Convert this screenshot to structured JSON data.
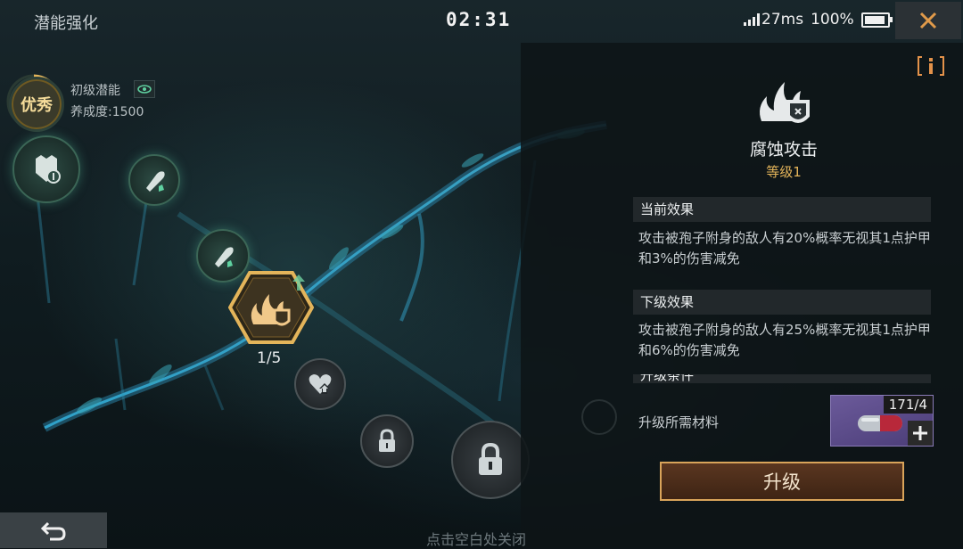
{
  "header": {
    "title": "潜能强化",
    "timer": "02:31",
    "ping": "27ms",
    "battery": "100%"
  },
  "potential": {
    "rank_badge": "优秀",
    "name": "初级潜能",
    "cultivation": "养成度:1500"
  },
  "tree": {
    "selected_progress": "1/5"
  },
  "detail": {
    "skill_name": "腐蚀攻击",
    "skill_level": "等级1",
    "current_effect_title": "当前效果",
    "current_effect_text": "攻击被孢子附身的敌人有20%概率无视其1点护甲和3%的伤害减免",
    "next_effect_title": "下级效果",
    "next_effect_text": "攻击被孢子附身的敌人有25%概率无视其1点护甲和6%的伤害减免",
    "upgrade_condition_title": "升级条件",
    "material_label": "升级所需材料",
    "material_count": "171/4",
    "upgrade_button": "升级"
  },
  "footer": {
    "hint": "点击空白处关闭"
  },
  "colors": {
    "accent_gold": "#e3b45a",
    "button_border": "#d9a45a",
    "vine_blue": "#3aa6d8"
  }
}
